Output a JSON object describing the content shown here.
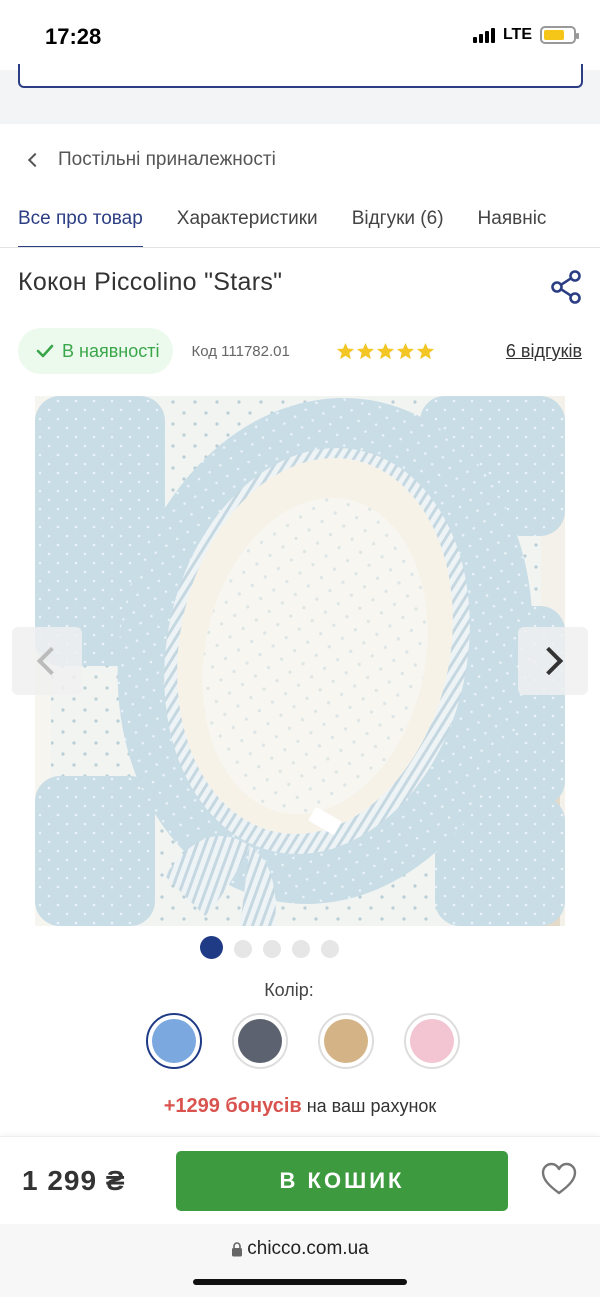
{
  "status_bar": {
    "time": "17:28",
    "network": "LTE"
  },
  "breadcrumb": {
    "label": "Постільні приналежності"
  },
  "tabs": [
    {
      "label": "Все про товар",
      "active": true
    },
    {
      "label": "Характеристики",
      "active": false
    },
    {
      "label": "Відгуки (6)",
      "active": false
    },
    {
      "label": "Наявніс",
      "active": false
    }
  ],
  "product": {
    "title": "Кокон Piccolino \"Stars\"",
    "stock_status": "В наявності",
    "code": "Код 111782.01",
    "rating": 5,
    "reviews_link": "6 відгуків"
  },
  "gallery": {
    "current_index": 1,
    "total": 5
  },
  "color": {
    "label": "Колір:",
    "options": [
      {
        "color": "#7aa8df",
        "selected": true
      },
      {
        "color": "#5c6270",
        "selected": false
      },
      {
        "color": "#d4b486",
        "selected": false
      },
      {
        "color": "#f3c4d1",
        "selected": false
      }
    ]
  },
  "bonus": {
    "amount": "+1299 бонусів",
    "suffix": "на ваш рахунок"
  },
  "buy_bar": {
    "price": "1 299 ₴",
    "cart_button": "В КОШИК"
  },
  "browser": {
    "url": "chicco.com.ua"
  },
  "colors": {
    "brand_blue": "#2b3e83",
    "cart_green": "#3d9a3f",
    "stock_green": "#3aa64a",
    "bonus_red": "#d9534f",
    "star_yellow": "#f3c623"
  }
}
